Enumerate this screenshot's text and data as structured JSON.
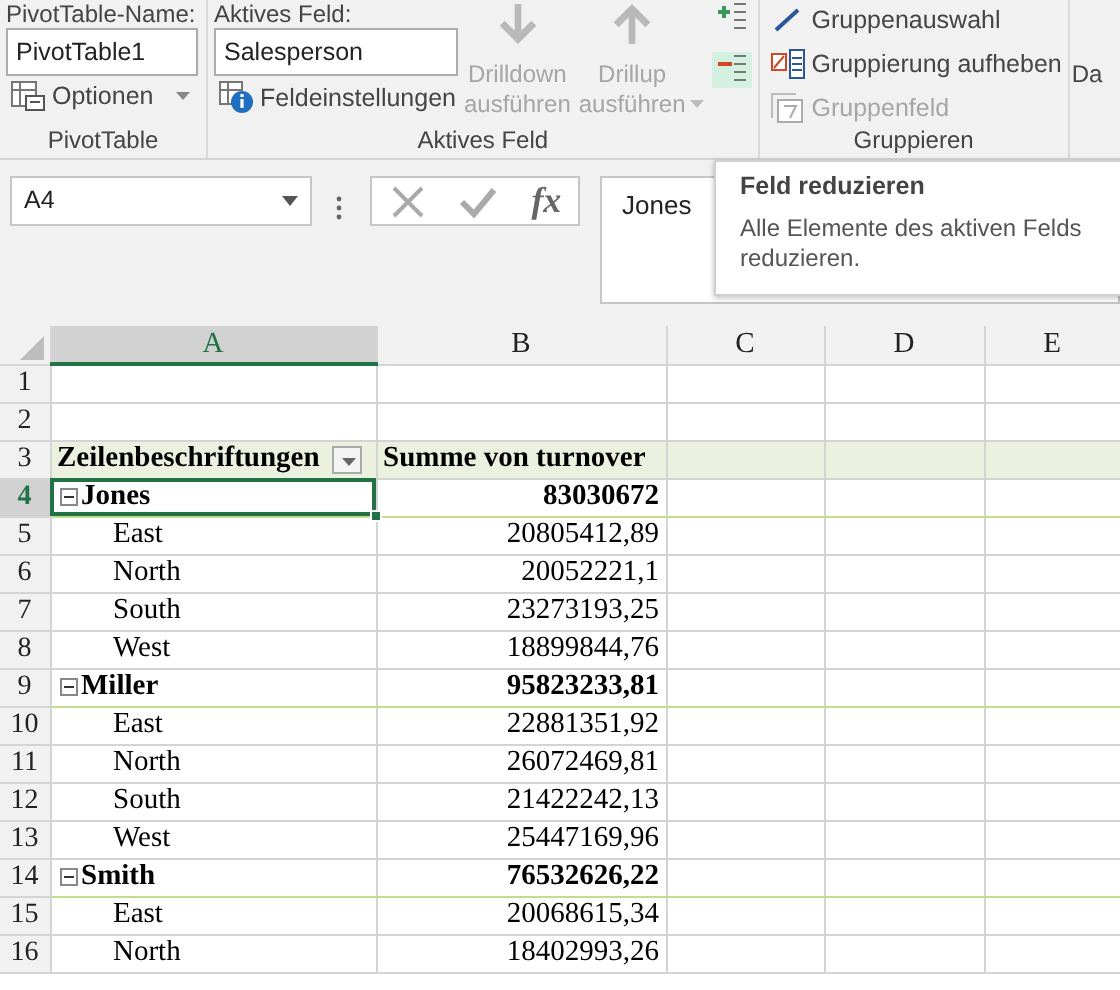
{
  "ribbon": {
    "pivottable": {
      "caption": "PivotTable-Name:",
      "value": "PivotTable1",
      "options_button": "Optionen",
      "label": "PivotTable"
    },
    "active_field": {
      "caption": "Aktives Feld:",
      "value": "Salesperson",
      "settings_button": "Feldeinstellungen",
      "drill_buttons": [
        {
          "kind": "down",
          "lines": [
            "Drilldown",
            "ausführen"
          ],
          "disabled": true
        },
        {
          "kind": "up",
          "lines": [
            "Drillup",
            "ausführen"
          ],
          "disabled": true
        }
      ],
      "expand_highlighted": false,
      "collapse_highlighted": true,
      "label": "Aktives Feld"
    },
    "grouping": {
      "items": [
        {
          "kind": "selection",
          "label": "Gruppenauswahl",
          "disabled": false
        },
        {
          "kind": "ungroup",
          "label": "Gruppierung aufheben",
          "disabled": false
        },
        {
          "kind": "field",
          "label": "Gruppenfeld",
          "disabled": true
        }
      ],
      "label": "Gruppieren"
    },
    "next_group_label": "Da"
  },
  "formula_bar": {
    "name_box": "A4",
    "fx": "fx",
    "content": "Jones"
  },
  "tooltip": {
    "title": "Feld reduzieren",
    "text": "Alle Elemente des aktiven Felds reduzieren."
  },
  "sheet": {
    "columns": [
      {
        "label": "A",
        "selected": true
      },
      {
        "label": "B",
        "selected": false
      },
      {
        "label": "C",
        "selected": false
      },
      {
        "label": "D",
        "selected": false
      },
      {
        "label": "E",
        "selected": false
      }
    ],
    "rows": [
      {
        "number": "1",
        "kind": "empty",
        "selected": false
      },
      {
        "number": "2",
        "kind": "empty",
        "selected": false
      },
      {
        "number": "3",
        "kind": "header",
        "selected": false,
        "cells": [
          "Zeilenbeschriftungen",
          "Summe von turnover"
        ]
      },
      {
        "number": "4",
        "kind": "group",
        "selected": true,
        "expanded": true,
        "cells": [
          "Jones",
          "83030672"
        ]
      },
      {
        "number": "5",
        "kind": "item",
        "selected": false,
        "cells": [
          "East",
          "20805412,89"
        ]
      },
      {
        "number": "6",
        "kind": "item",
        "selected": false,
        "cells": [
          "North",
          "20052221,1"
        ]
      },
      {
        "number": "7",
        "kind": "item",
        "selected": false,
        "cells": [
          "South",
          "23273193,25"
        ]
      },
      {
        "number": "8",
        "kind": "item",
        "selected": false,
        "cells": [
          "West",
          "18899844,76"
        ]
      },
      {
        "number": "9",
        "kind": "group",
        "selected": false,
        "expanded": true,
        "cells": [
          "Miller",
          "95823233,81"
        ]
      },
      {
        "number": "10",
        "kind": "item",
        "selected": false,
        "cells": [
          "East",
          "22881351,92"
        ]
      },
      {
        "number": "11",
        "kind": "item",
        "selected": false,
        "cells": [
          "North",
          "26072469,81"
        ]
      },
      {
        "number": "12",
        "kind": "item",
        "selected": false,
        "cells": [
          "South",
          "21422242,13"
        ]
      },
      {
        "number": "13",
        "kind": "item",
        "selected": false,
        "cells": [
          "West",
          "25447169,96"
        ]
      },
      {
        "number": "14",
        "kind": "group",
        "selected": false,
        "expanded": true,
        "cells": [
          "Smith",
          "76532626,22"
        ]
      },
      {
        "number": "15",
        "kind": "item",
        "selected": false,
        "cells": [
          "East",
          "20068615,34"
        ]
      },
      {
        "number": "16",
        "kind": "item",
        "selected": false,
        "cells": [
          "North",
          "18402993,26"
        ]
      }
    ]
  }
}
